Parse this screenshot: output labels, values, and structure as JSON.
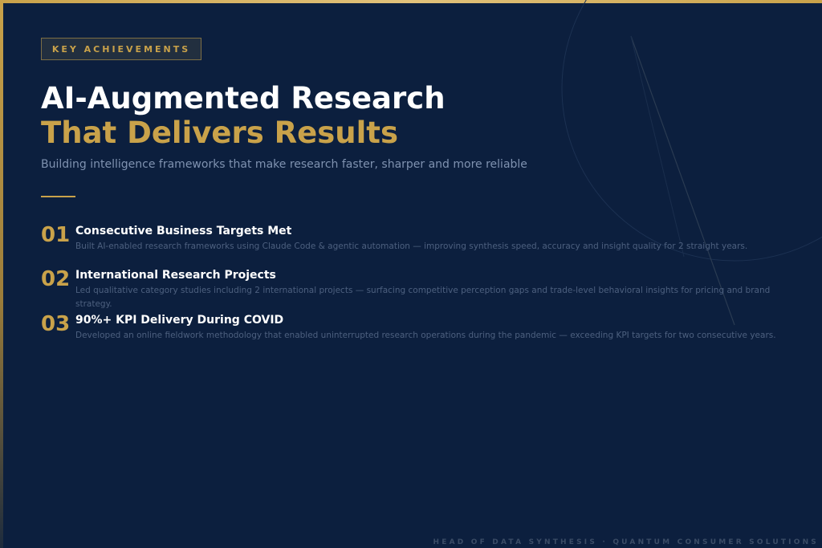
{
  "badge": "KEY ACHIEVEMENTS",
  "title": {
    "line1": "AI-Augmented Research",
    "line2": "That Delivers Results"
  },
  "subtitle": "Building intelligence frameworks that make research faster, sharper and more reliable",
  "achievements": [
    {
      "number": "01",
      "title": "Consecutive Business Targets Met",
      "description": "Built AI-enabled research frameworks using Claude Code & agentic automation — improving synthesis speed, accuracy and insight quality for 2 straight years."
    },
    {
      "number": "02",
      "title": "International Research Projects",
      "description": "Led qualitative category studies including 2 international projects — surfacing competitive perception gaps and trade-level behavioral insights for pricing and brand strategy."
    },
    {
      "number": "03",
      "title": "90%+ KPI Delivery During COVID",
      "description": "Developed an online fieldwork methodology that enabled uninterrupted research operations during the pandemic — exceeding KPI targets for two consecutive years."
    }
  ],
  "footer": "HEAD OF DATA SYNTHESIS · QUANTUM CONSUMER SOLUTIONS",
  "colors": {
    "background": "#0c1f3e",
    "accent_gold": "#c9a24a",
    "heading_white": "#ffffff",
    "muted_text": "#7f92b0"
  }
}
